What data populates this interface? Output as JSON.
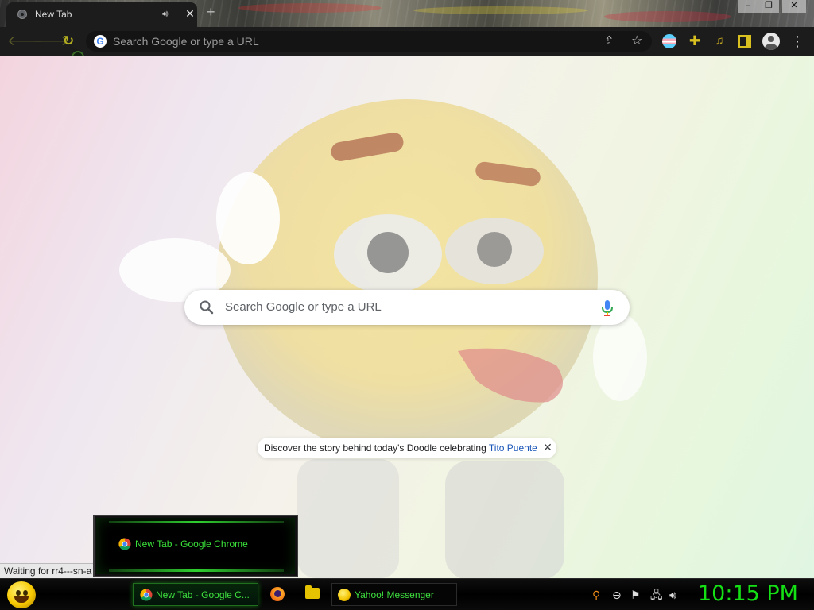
{
  "browser": {
    "tab": {
      "title": "New Tab",
      "audio_icon": "speaker-icon",
      "close": "✕"
    },
    "new_tab_symbol": "+",
    "window_controls": [
      "–",
      "❐",
      "✕"
    ],
    "omnibox": {
      "placeholder": "Search Google or type a URL"
    },
    "toolbar_icons": [
      "back-arrow-icon",
      "forward-arrow-icon",
      "reload-icon",
      "share-icon",
      "star-icon",
      "pride-flag-extension-icon",
      "puzzle-extensions-icon",
      "media-controls-icon",
      "side-panel-icon",
      "profile-icon",
      "three-dot-menu-icon"
    ]
  },
  "newtab": {
    "search_placeholder": "Search Google or type a URL",
    "doodle_note": {
      "text": "Discover the story behind today's Doodle celebrating ",
      "link": "Tito Puente",
      "close": "✕"
    }
  },
  "status_bubble": "Waiting for rr4---sn-a",
  "taskbar_preview": {
    "label": "New Tab - Google Chrome"
  },
  "taskbar": {
    "tasks": [
      {
        "label": "New Tab - Google C...",
        "icon": "chrome-icon",
        "active": true
      },
      {
        "label": "Yahoo! Messenger",
        "icon": "yahoo-messenger-icon",
        "active": false
      }
    ],
    "quicklaunch": [
      "firefox-icon",
      "folder-icon"
    ],
    "tray_icons": [
      "search-tray-icon",
      "messenger-tray-icon",
      "action-center-flag-icon",
      "network-icon",
      "volume-icon"
    ],
    "clock": "10:15 PM"
  },
  "colors": {
    "accent_yellow": "#d8c020",
    "taskbar_green": "#3ee03e",
    "clock_green": "#15e015",
    "link_blue": "#1a56b8"
  }
}
